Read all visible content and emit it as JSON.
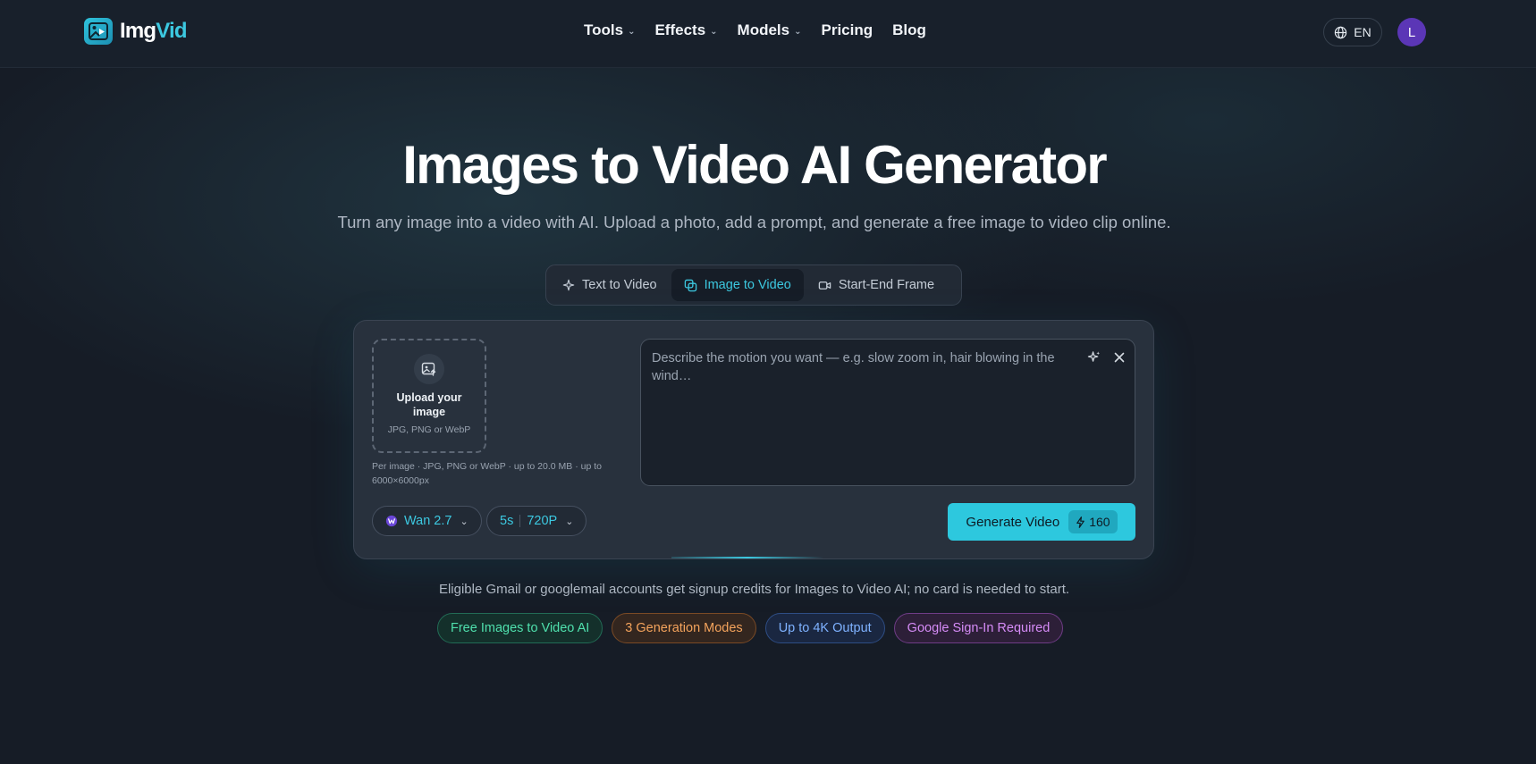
{
  "brand": {
    "name_part1": "Img",
    "name_part2": "Vid",
    "accent_color": "#3cc8e0"
  },
  "nav": {
    "items": [
      {
        "label": "Tools",
        "has_dropdown": true
      },
      {
        "label": "Effects",
        "has_dropdown": true
      },
      {
        "label": "Models",
        "has_dropdown": true
      },
      {
        "label": "Pricing",
        "has_dropdown": false
      },
      {
        "label": "Blog",
        "has_dropdown": false
      }
    ],
    "language": "EN",
    "avatar_initial": "L",
    "avatar_color": "#5b36b6"
  },
  "hero": {
    "title": "Images to Video AI Generator",
    "subtitle": "Turn any image into a video with AI. Upload a photo, add a prompt, and generate a free image to video clip online."
  },
  "tabs": [
    {
      "label": "Text to Video",
      "icon": "sparkles-icon",
      "active": false
    },
    {
      "label": "Image to Video",
      "icon": "images-icon",
      "active": true
    },
    {
      "label": "Start-End Frame",
      "icon": "video-camera-icon",
      "active": false
    }
  ],
  "upload": {
    "label": "Upload your image",
    "hint": "JPG, PNG or WebP",
    "note": "Per image · JPG, PNG or WebP · up to 20.0 MB · up to 6000×6000px"
  },
  "prompt": {
    "placeholder": "Describe the motion you want — e.g. slow zoom in, hair blowing in the wind…",
    "value": ""
  },
  "settings": {
    "model": "Wan 2.7",
    "duration": "5s",
    "resolution": "720P"
  },
  "generate": {
    "label": "Generate Video",
    "credits": "160"
  },
  "notice": "Eligible Gmail or googlemail accounts get signup credits for Images to Video AI; no card is needed to start.",
  "badges": [
    {
      "label": "Free Images to Video AI",
      "color": "#4fe0ad"
    },
    {
      "label": "3 Generation Modes",
      "color": "#f4a35c"
    },
    {
      "label": "Up to 4K Output",
      "color": "#7fb2ff"
    },
    {
      "label": "Google Sign-In Required",
      "color": "#d58bf6"
    }
  ]
}
